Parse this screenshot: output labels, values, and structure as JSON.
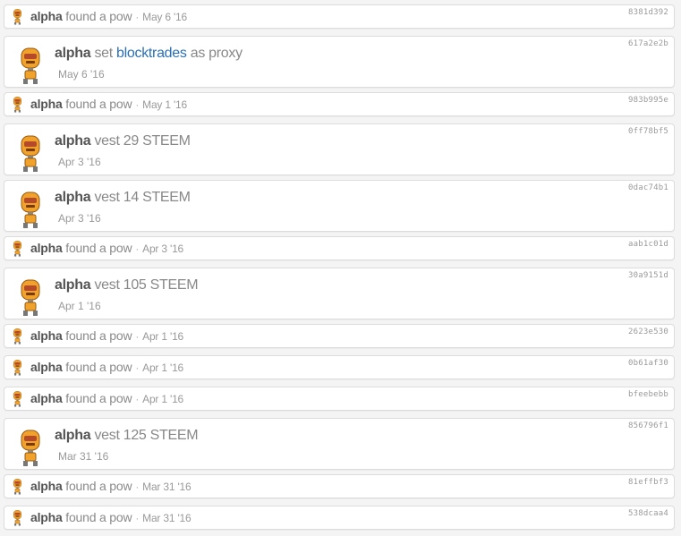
{
  "feed": {
    "rows": [
      {
        "size": "small",
        "user": "alpha",
        "action": "found a pow",
        "date": "May 6 '16",
        "hash": "8381d392"
      },
      {
        "size": "big",
        "user": "alpha",
        "action": "set",
        "link": "blocktrades",
        "action_after": "as proxy",
        "date": "May 6 '16",
        "hash": "617a2e2b"
      },
      {
        "size": "small",
        "user": "alpha",
        "action": "found a pow",
        "date": "May 1 '16",
        "hash": "983b995e"
      },
      {
        "size": "big",
        "user": "alpha",
        "action": "vest 29 STEEM",
        "date": "Apr 3 '16",
        "hash": "0ff78bf5"
      },
      {
        "size": "big",
        "user": "alpha",
        "action": "vest 14 STEEM",
        "date": "Apr 3 '16",
        "hash": "0dac74b1"
      },
      {
        "size": "small",
        "user": "alpha",
        "action": "found a pow",
        "date": "Apr 3 '16",
        "hash": "aab1c01d"
      },
      {
        "size": "big",
        "user": "alpha",
        "action": "vest 105 STEEM",
        "date": "Apr 1 '16",
        "hash": "30a9151d"
      },
      {
        "size": "small",
        "user": "alpha",
        "action": "found a pow",
        "date": "Apr 1 '16",
        "hash": "2623e530"
      },
      {
        "size": "small",
        "user": "alpha",
        "action": "found a pow",
        "date": "Apr 1 '16",
        "hash": "0b61af30"
      },
      {
        "size": "small",
        "user": "alpha",
        "action": "found a pow",
        "date": "Apr 1 '16",
        "hash": "bfeebebb"
      },
      {
        "size": "big",
        "user": "alpha",
        "action": "vest 125 STEEM",
        "date": "Mar 31 '16",
        "hash": "856796f1"
      },
      {
        "size": "small",
        "user": "alpha",
        "action": "found a pow",
        "date": "Mar 31 '16",
        "hash": "81effbf3"
      },
      {
        "size": "small",
        "user": "alpha",
        "action": "found a pow",
        "date": "Mar 31 '16",
        "hash": "538dcaa4"
      }
    ],
    "separator": "·",
    "avatar_icon": "robot-avatar-icon"
  },
  "colors": {
    "link": "#2b6fb6",
    "avatar_body": "#f0a22a",
    "avatar_face": "#b54a2a"
  }
}
